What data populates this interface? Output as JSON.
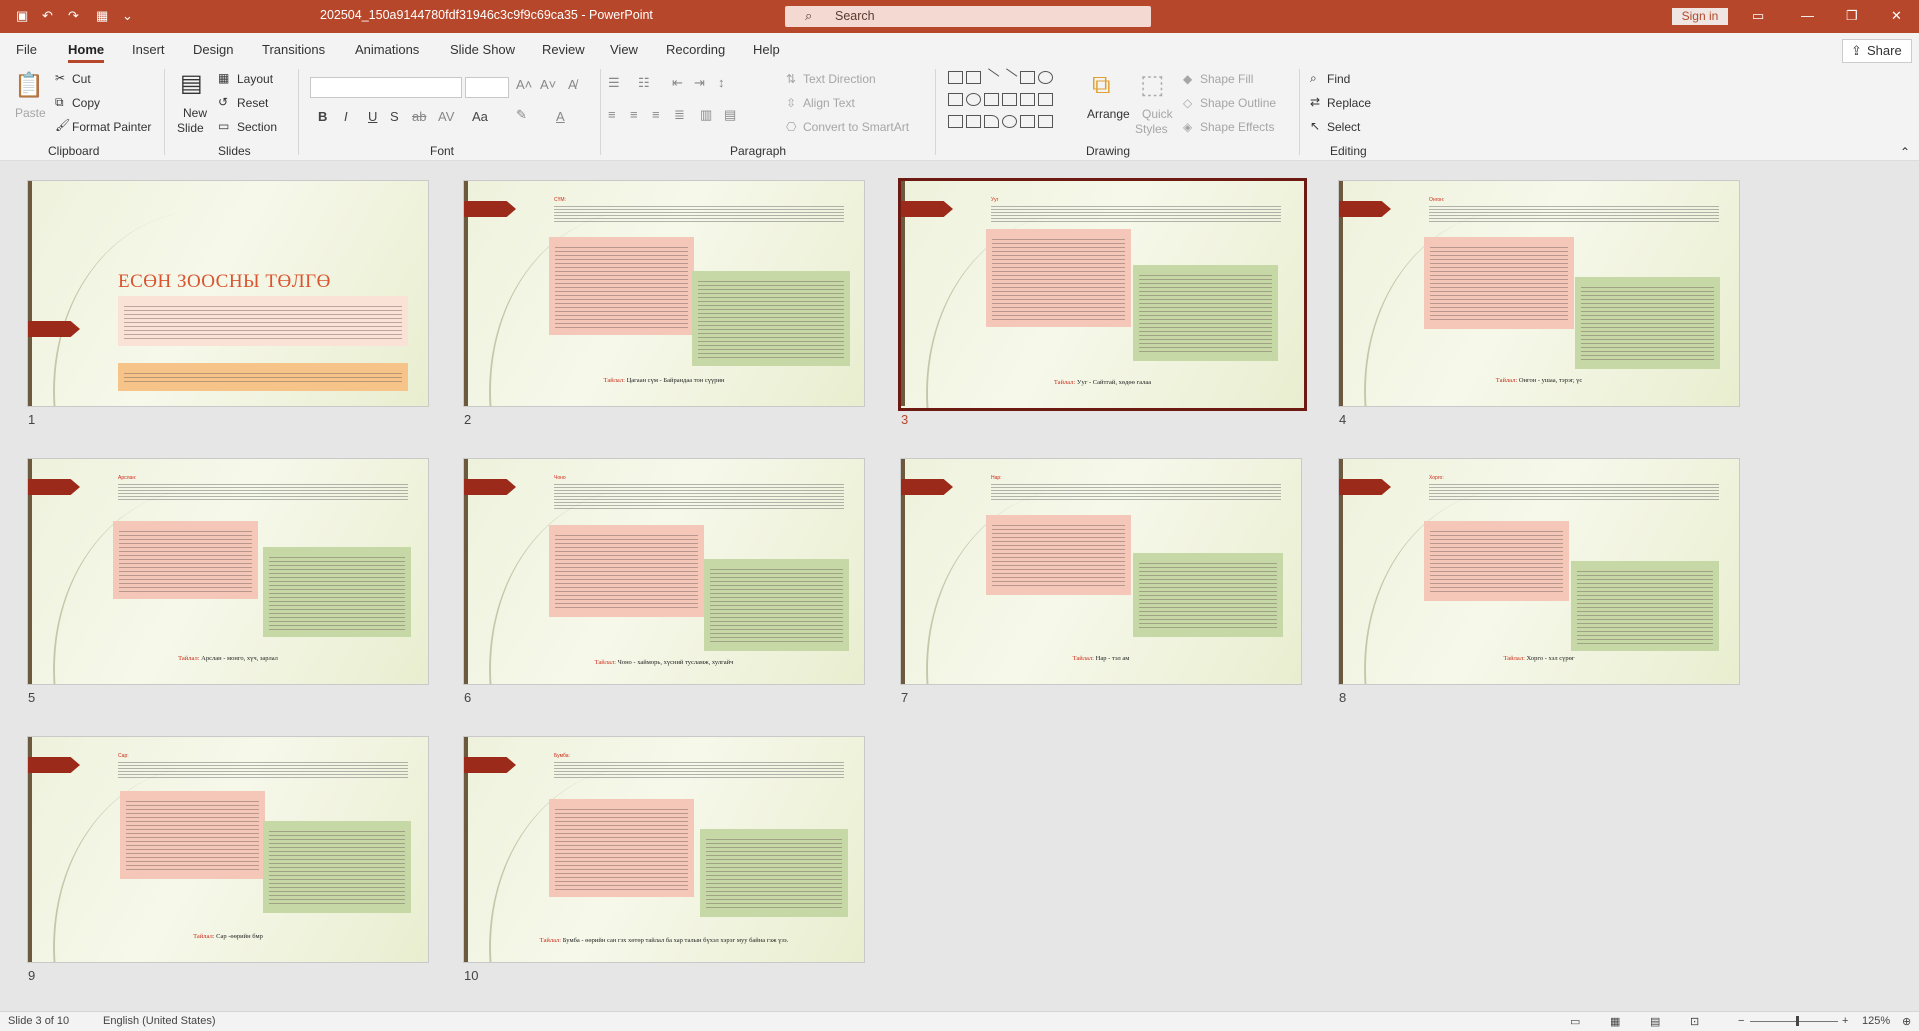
{
  "titlebar": {
    "doc_title": "202504_150a9144780fdf31946c3c9f9c69ca35  -  PowerPoint",
    "search_placeholder": "Search",
    "sign_in": "Sign in",
    "icons": [
      "save-icon",
      "undo-icon",
      "redo-icon",
      "present-icon",
      "customize-icon"
    ]
  },
  "tabs": [
    "File",
    "Home",
    "Insert",
    "Design",
    "Transitions",
    "Animations",
    "Slide Show",
    "Review",
    "View",
    "Recording",
    "Help"
  ],
  "share_label": "Share",
  "ribbon": {
    "clipboard": {
      "paste": "Paste",
      "cut": "Cut",
      "copy": "Copy",
      "format_painter": "Format Painter",
      "group": "Clipboard"
    },
    "slides": {
      "new_slide_1": "New",
      "new_slide_2": "Slide",
      "layout": "Layout",
      "reset": "Reset",
      "section": "Section",
      "group": "Slides"
    },
    "font": {
      "group": "Font",
      "bold": "B",
      "italic": "I",
      "underline": "U",
      "strike": "S",
      "aa": "Aa"
    },
    "paragraph": {
      "text_direction": "Text Direction",
      "align_text": "Align Text",
      "convert": "Convert to SmartArt",
      "group": "Paragraph"
    },
    "drawing": {
      "arrange": "Arrange",
      "quick_1": "Quick",
      "quick_2": "Styles",
      "fill": "Shape Fill",
      "outline": "Shape Outline",
      "effects": "Shape Effects",
      "group": "Drawing"
    },
    "editing": {
      "find": "Find",
      "replace": "Replace",
      "select": "Select",
      "group": "Editing"
    }
  },
  "slides": [
    {
      "num": "1",
      "title": "ЕСӨН ЗООСНЫ ТӨЛГӨ",
      "caption_label": "",
      "caption": ""
    },
    {
      "num": "2",
      "title": "СҮМ:",
      "caption_label": "Тайлал:",
      "caption": "Цагаан сүм - Байрандаа тон сүүрин"
    },
    {
      "num": "3",
      "title": "Ууг",
      "caption_label": "Тайлал:",
      "caption": "Ууг - Сайтгай, хөдөө галаа"
    },
    {
      "num": "4",
      "title": "Онгон:",
      "caption_label": "Тайлал:",
      "caption": "Онгон - ушаа, тэрэг, үс"
    },
    {
      "num": "5",
      "title": "Арслан:",
      "caption_label": "Тайлал:",
      "caption": "Арслан - монго, хүч, зарлал"
    },
    {
      "num": "6",
      "title": "Чоно",
      "caption_label": "Тайлал:",
      "caption": "Чоно - хайморь, хүсний тусламж, хулгайч"
    },
    {
      "num": "7",
      "title": "Нар:",
      "caption_label": "Тайлал:",
      "caption": "Нар - тэл ам"
    },
    {
      "num": "8",
      "title": "Хорго:",
      "caption_label": "Тайлал:",
      "caption": "Хорго - хэл сүрөг"
    },
    {
      "num": "9",
      "title": "Сар:",
      "caption_label": "Тайлал:",
      "caption": "Сар -өөрийн бмр"
    },
    {
      "num": "10",
      "title": "Бумба:",
      "caption_label": "Тайлал:",
      "caption": "Бумба - өөрийн сан гэх хөтөр тайлал ба хар талын бүхэл хэрэг муу байна гэж үзэ."
    }
  ],
  "status": {
    "slide_info": "Slide 3 of 10",
    "language": "English (United States)",
    "zoom": "125%"
  },
  "colors": {
    "accent": "#b7472a",
    "selected_outline": "#6d1a12",
    "pink_box": "#f4c7b9",
    "green_box": "#c7d8a7"
  }
}
